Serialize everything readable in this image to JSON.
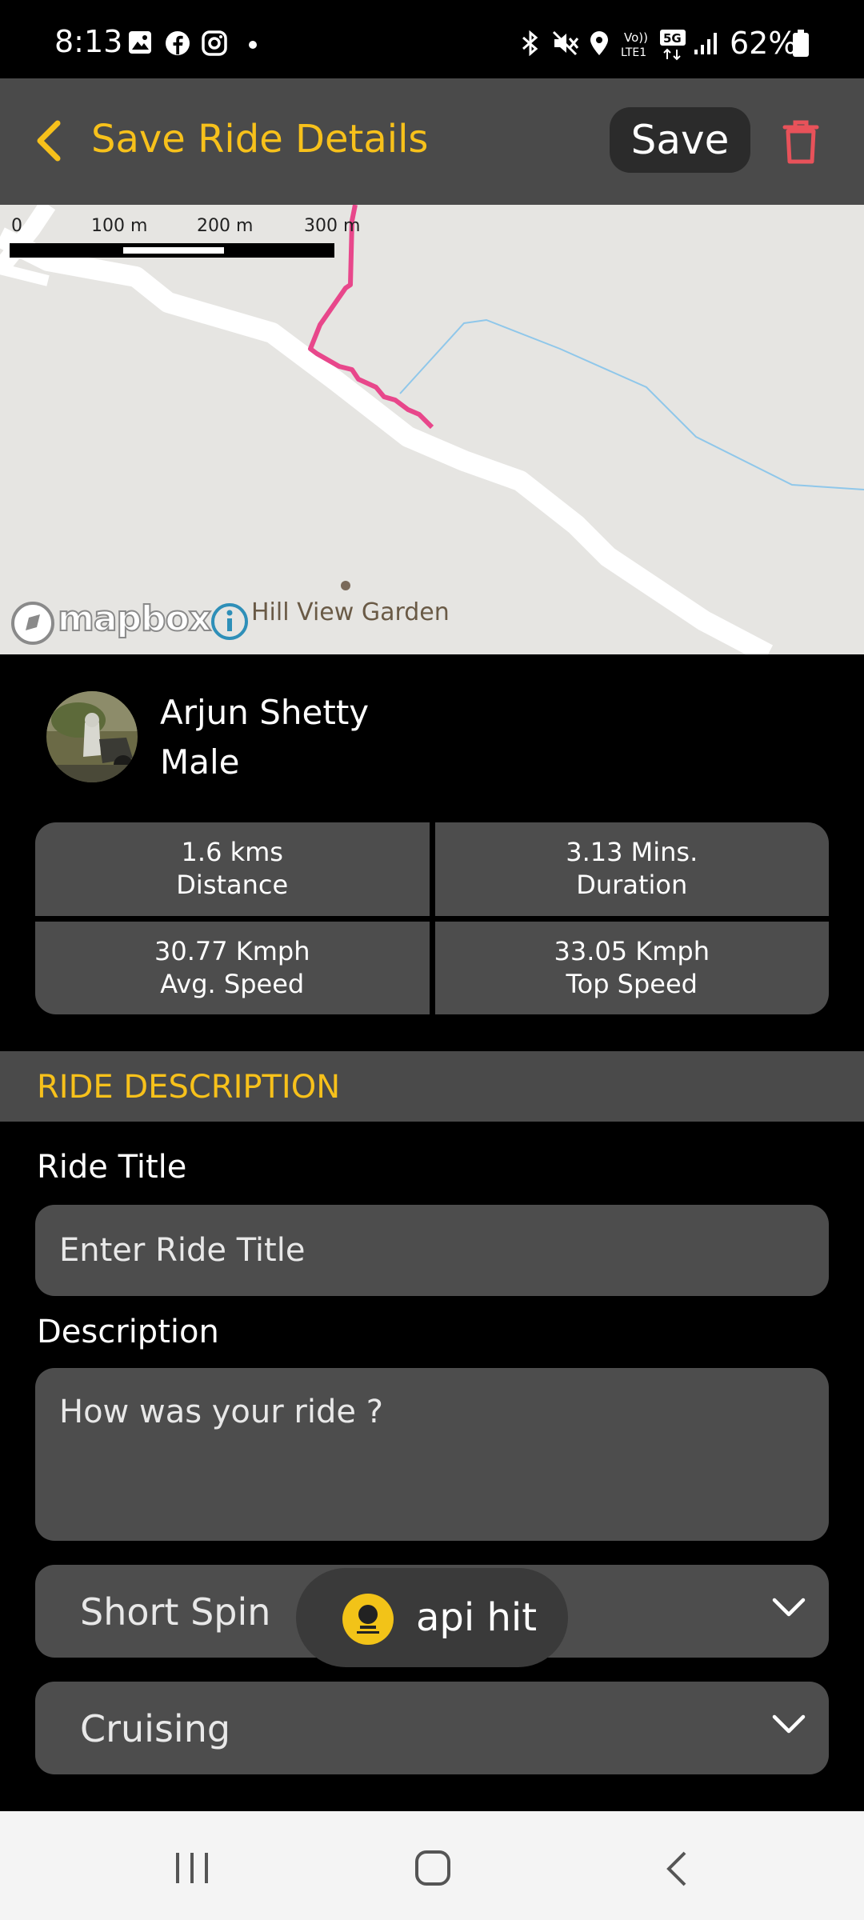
{
  "status_bar": {
    "time": "8:13",
    "battery": "62%"
  },
  "app_bar": {
    "title": "Save Ride Details",
    "save_label": "Save"
  },
  "map": {
    "scale_labels": [
      "0",
      "100 m",
      "200 m",
      "300 m"
    ],
    "place_label": "Hill View Garden",
    "attribution": "mapbox",
    "route_color": "#e8478b"
  },
  "profile": {
    "name": "Arjun Shetty",
    "gender": "Male"
  },
  "stats": [
    {
      "value": "1.6 kms",
      "label": "Distance"
    },
    {
      "value": "3.13 Mins.",
      "label": "Duration"
    },
    {
      "value": "30.77 Kmph",
      "label": "Avg. Speed"
    },
    {
      "value": "33.05 Kmph",
      "label": "Top Speed"
    }
  ],
  "ride_description": {
    "header": "RIDE DESCRIPTION",
    "title_label": "Ride Title",
    "title_placeholder": "Enter Ride Title",
    "description_label": "Description",
    "description_placeholder": "How was your ride ?",
    "ride_type": "Short Spin",
    "ride_style": "Cruising"
  },
  "toast": {
    "text": "api hit"
  },
  "colors": {
    "accent": "#f7c11b",
    "delete": "#e8525a",
    "panel": "#4d4d4d"
  }
}
